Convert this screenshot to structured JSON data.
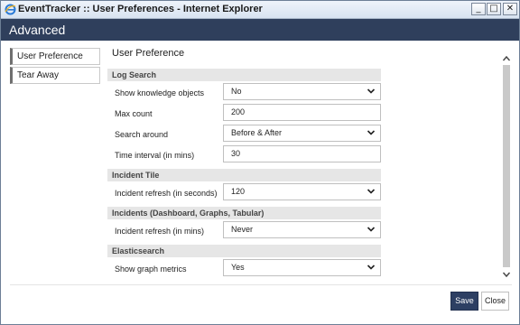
{
  "window": {
    "title": "EventTracker :: User Preferences - Internet Explorer",
    "controls": {
      "minimize": "_",
      "maximize": "□",
      "close": "✕"
    }
  },
  "header": {
    "title": "Advanced"
  },
  "sidebar": {
    "items": [
      {
        "label": "User Preference"
      },
      {
        "label": "Tear Away"
      }
    ]
  },
  "main": {
    "title": "User Preference",
    "sections": {
      "log_search": {
        "label": "Log Search",
        "show_knowledge_objects": {
          "label": "Show knowledge objects",
          "value": "No"
        },
        "max_count": {
          "label": "Max count",
          "value": "200"
        },
        "search_around": {
          "label": "Search around",
          "value": "Before & After"
        },
        "time_interval": {
          "label": "Time interval (in mins)",
          "value": "30"
        }
      },
      "incident_tile": {
        "label": "Incident Tile",
        "incident_refresh": {
          "label": "Incident refresh (in seconds)",
          "value": "120"
        }
      },
      "incidents": {
        "label": "Incidents (Dashboard, Graphs, Tabular)",
        "incident_refresh": {
          "label": "Incident refresh (in mins)",
          "value": "Never"
        }
      },
      "elasticsearch": {
        "label": "Elasticsearch",
        "show_graph_metrics": {
          "label": "Show graph metrics",
          "value": "Yes"
        }
      }
    }
  },
  "footer": {
    "save_label": "Save",
    "close_label": "Close"
  },
  "colors": {
    "header_bg": "#2f3f5c",
    "save_bg": "#2d3f63",
    "section_bg": "#e6e6e6"
  }
}
